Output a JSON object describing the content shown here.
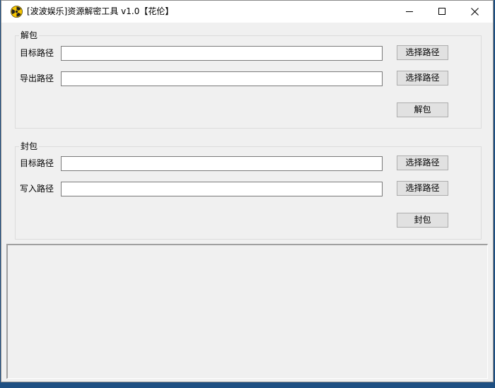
{
  "window": {
    "title": "[波波娱乐]资源解密工具 v1.0【花伦】",
    "icon": "radiation-icon",
    "controls": [
      "minimize-icon",
      "maximize-icon",
      "close-icon"
    ]
  },
  "unpack": {
    "group_label": "解包",
    "target_label": "目标路径",
    "target_value": "",
    "target_browse": "选择路径",
    "output_label": "导出路径",
    "output_value": "",
    "output_browse": "选择路径",
    "action_label": "解包"
  },
  "pack": {
    "group_label": "封包",
    "target_label": "目标路径",
    "target_value": "",
    "target_browse": "选择路径",
    "write_label": "写入路径",
    "write_value": "",
    "write_browse": "选择路径",
    "action_label": "封包"
  },
  "log": {
    "text": ""
  },
  "colors": {
    "window_bg": "#f0f0f0",
    "titlebar_bg": "#ffffff",
    "desktop_bg": "#1e4f82",
    "icon_yellow": "#f5c400"
  }
}
